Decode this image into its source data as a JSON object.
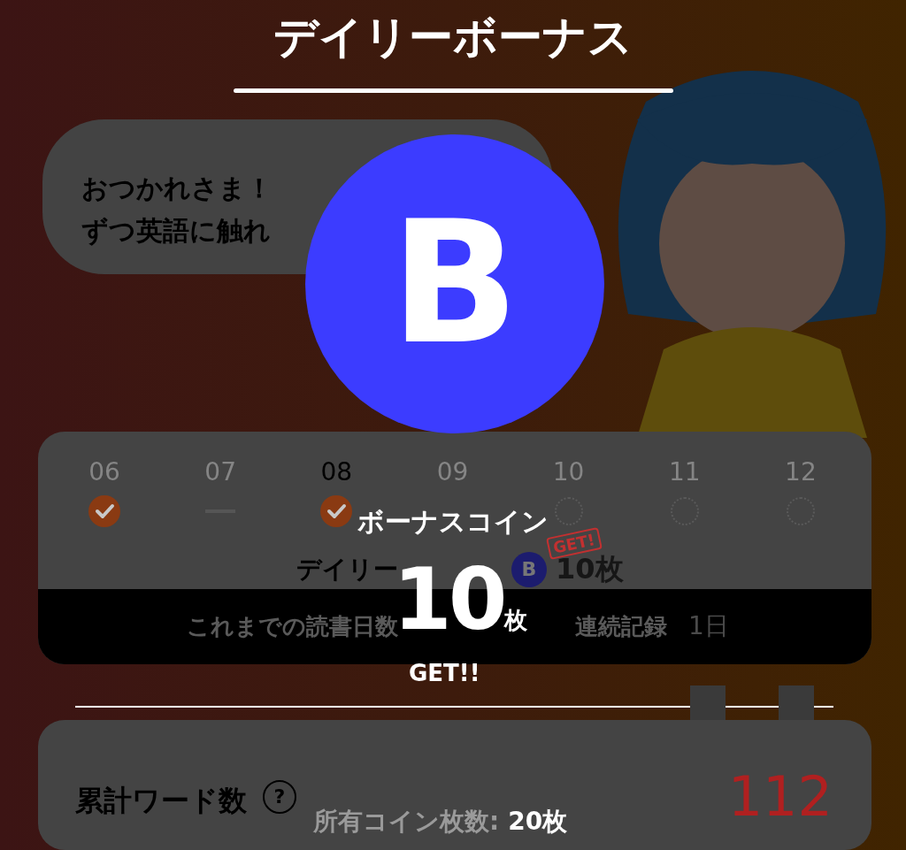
{
  "title": "デイリーボーナス",
  "message": {
    "lines": [
      "おつかれさま！",
      "ずつ英語に触れ"
    ]
  },
  "calendar": {
    "days": [
      {
        "date": "06",
        "kind": "done",
        "current": false
      },
      {
        "date": "07",
        "kind": "missed",
        "current": false
      },
      {
        "date": "08",
        "kind": "done",
        "current": true
      },
      {
        "date": "09",
        "kind": "hidden",
        "current": false
      },
      {
        "date": "10",
        "kind": "pending",
        "current": false
      },
      {
        "date": "11",
        "kind": "pending",
        "current": false
      },
      {
        "date": "12",
        "kind": "pending",
        "current": false
      }
    ]
  },
  "daily_bonus": {
    "label": "デイリー",
    "coin": "B",
    "amount": "10枚",
    "stamp": "GET!"
  },
  "stats": {
    "reading_days_label": "これまでの読書日数",
    "streak_label": "連続記録",
    "streak_value": "1日"
  },
  "total_words": {
    "label": "累計ワード数",
    "help": "?",
    "value": "112"
  },
  "reward": {
    "coin": "B",
    "heading": "ボーナスコイン",
    "amount": "10",
    "unit": "枚",
    "get": "GET!!",
    "balance_label": "所有コイン枚数:",
    "balance_value": "20枚"
  }
}
